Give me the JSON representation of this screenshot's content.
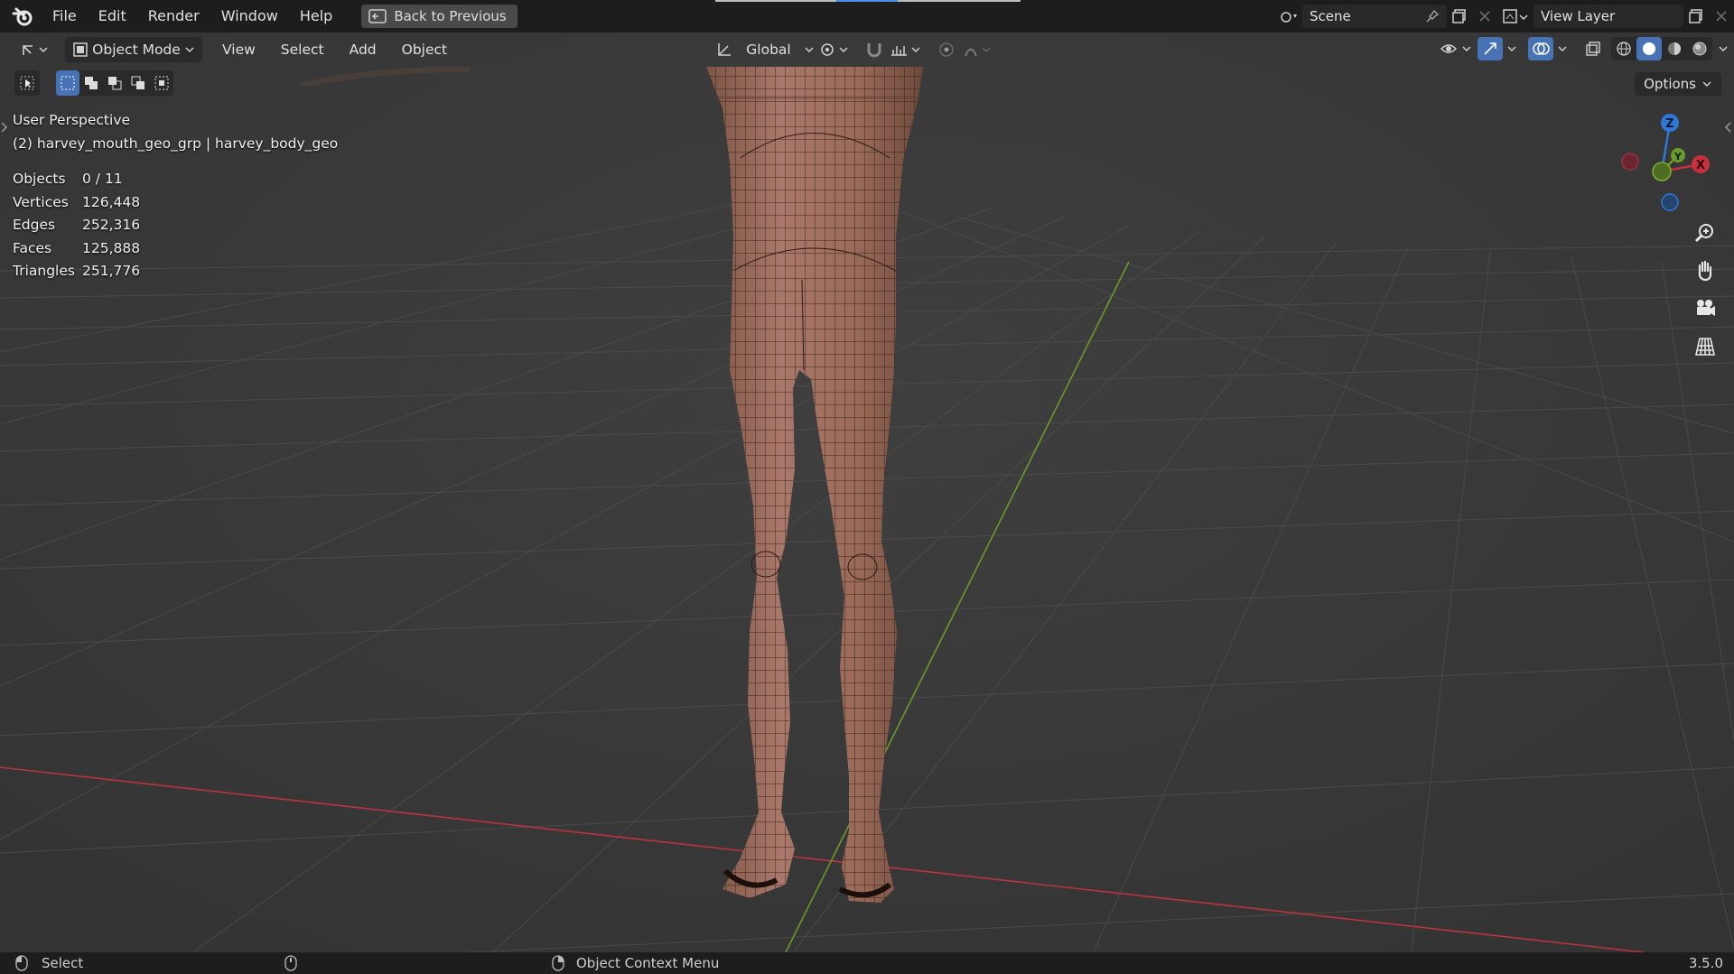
{
  "menu": {
    "file": "File",
    "edit": "Edit",
    "render": "Render",
    "window": "Window",
    "help": "Help",
    "back": "Back to Previous"
  },
  "scene": {
    "name": "Scene"
  },
  "view_layer": {
    "name": "View Layer"
  },
  "header": {
    "mode": "Object Mode",
    "view": "View",
    "select": "Select",
    "add": "Add",
    "object": "Object",
    "orientation": "Global"
  },
  "options": "Options",
  "viewport": {
    "perspective": "User Perspective",
    "object_info": "(2) harvey_mouth_geo_grp | harvey_body_geo"
  },
  "stats": [
    {
      "k": "Objects",
      "v": "0 / 11"
    },
    {
      "k": "Vertices",
      "v": "126,448"
    },
    {
      "k": "Edges",
      "v": "252,316"
    },
    {
      "k": "Faces",
      "v": "125,888"
    },
    {
      "k": "Triangles",
      "v": "251,776"
    }
  ],
  "gizmo": {
    "z": "Z",
    "y": "Y",
    "x": "X"
  },
  "status": {
    "left": "Select",
    "mid": "Object Context Menu",
    "version": "3.5.0"
  },
  "colors": {
    "accent": "#4772b3",
    "x_axis": "#c8303f",
    "y_axis": "#6a9a28",
    "z_axis": "#2f77d6",
    "skin": "#9a6a55"
  }
}
